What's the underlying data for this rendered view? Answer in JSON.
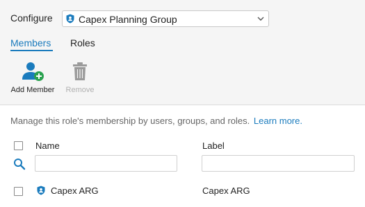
{
  "configure": {
    "label": "Configure",
    "selected_group": "Capex Planning Group",
    "group_icon": "shield-person-icon"
  },
  "tabs": [
    {
      "label": "Members",
      "active": true
    },
    {
      "label": "Roles",
      "active": false
    }
  ],
  "toolbar": {
    "add_member_label": "Add Member",
    "remove_label": "Remove",
    "remove_enabled": false
  },
  "description": {
    "text": "Manage this role's membership by users, groups, and roles.",
    "link": "Learn more."
  },
  "table": {
    "columns": [
      "Name",
      "Label"
    ],
    "filters": {
      "name": "",
      "label": ""
    },
    "rows": [
      {
        "name": "Capex ARG",
        "label": "Capex ARG",
        "icon": "shield-person-icon",
        "checked": false
      }
    ]
  },
  "colors": {
    "accent": "#1a7bbd",
    "add_badge": "#2aa14f",
    "disabled": "#b0b0b0"
  }
}
